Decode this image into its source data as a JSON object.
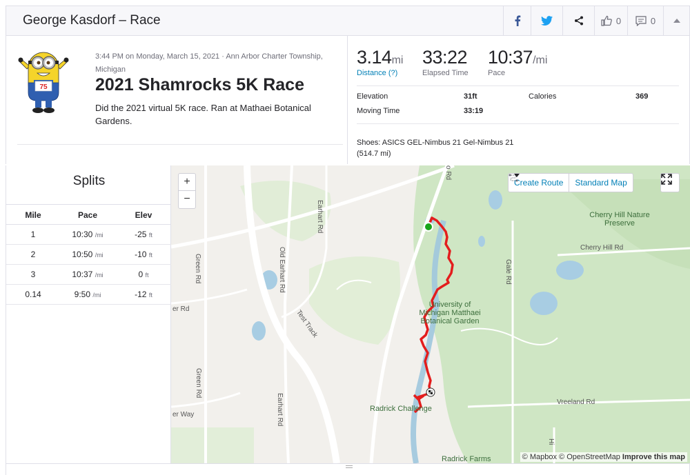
{
  "header": {
    "title": "George Kasdorf – Race",
    "kudos_count": "0",
    "comment_count": "0"
  },
  "activity": {
    "meta": "3:44 PM on Monday, March 15, 2021 · Ann Arbor Charter Township, Michigan",
    "title": "2021 Shamrocks 5K Race",
    "description": "Did the 2021 virtual 5K race. Ran at Mathaei Botanical Gardens.",
    "avatar_bib": "75"
  },
  "stats": {
    "distance": {
      "value": "3.14",
      "unit": "mi",
      "label": "Distance (?)"
    },
    "elapsed": {
      "value": "33:22",
      "label": "Elapsed Time"
    },
    "pace": {
      "value": "10:37",
      "unit": "/mi",
      "label": "Pace"
    }
  },
  "details": {
    "elevation_label": "Elevation",
    "elevation_value": "31ft",
    "calories_label": "Calories",
    "calories_value": "369",
    "moving_label": "Moving Time",
    "moving_value": "33:19",
    "shoes": "Shoes: ASICS GEL-Nimbus 21 Gel-Nimbus 21 (514.7 mi)"
  },
  "splits": {
    "title": "Splits",
    "headers": [
      "Mile",
      "Pace",
      "Elev"
    ],
    "rows": [
      {
        "mile": "1",
        "pace": "10:30",
        "pace_unit": "/mi",
        "elev": "-25",
        "elev_unit": "ft"
      },
      {
        "mile": "2",
        "pace": "10:50",
        "pace_unit": "/mi",
        "elev": "-10",
        "elev_unit": "ft"
      },
      {
        "mile": "3",
        "pace": "10:37",
        "pace_unit": "/mi",
        "elev": "0",
        "elev_unit": "ft"
      },
      {
        "mile": "0.14",
        "pace": "9:50",
        "pace_unit": "/mi",
        "elev": "-12",
        "elev_unit": "ft"
      }
    ]
  },
  "map": {
    "zoom_in": "+",
    "zoom_out": "−",
    "create_route": "Create Route",
    "map_type": "Standard Map",
    "attribution_mapbox": "© Mapbox",
    "attribution_osm": "© OpenStreetMap",
    "attribution_improve": "Improve this map",
    "labels": {
      "green_rd_1": "Green Rd",
      "green_rd_2": "Green Rd",
      "old_earhart": "Old Earhart Rd",
      "earhart_rd_1": "Earhart Rd",
      "earhart_rd_2": "Earhart Rd",
      "test_track": "Test Track",
      "gale_rd": "Gale Rd",
      "cherry_hill_rd": "Cherry Hill Rd",
      "cherry_hill_preserve": "Cherry Hill Nature Preserve",
      "umich": "University of Michigan Matthaei Botanical Garden",
      "radrick_challenge": "Radrick Challenge",
      "radrick_farms": "Radrick Farms",
      "vreeland_rd": "Vreeland Rd",
      "rd_left": "er Rd",
      "way_left": "er Way",
      "o_rd": "o Rd",
      "hi_rd": "Hi"
    }
  },
  "colors": {
    "brand_link": "#007fb6",
    "route": "#e31d1d",
    "start": "#1aa51a"
  }
}
